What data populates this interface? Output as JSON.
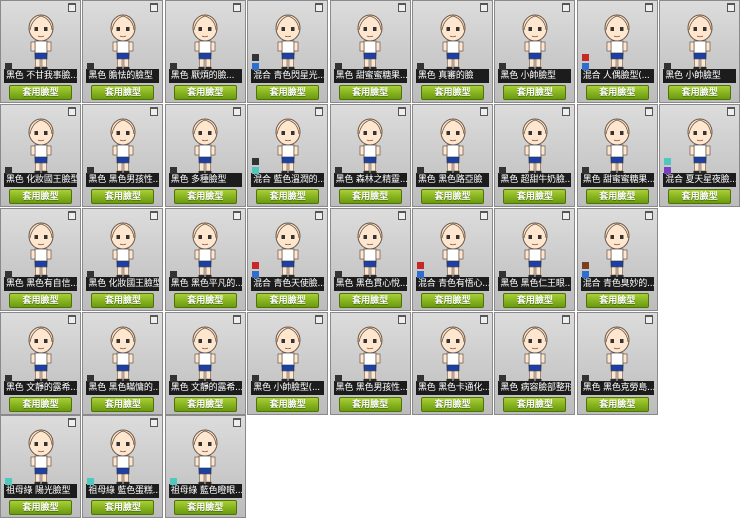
{
  "apply_label": "套用臉型",
  "colors": {
    "dark": "#333333",
    "blue": "#2f6ecf",
    "red": "#c62828",
    "teal": "#4fc9c0",
    "purple": "#7b3fc4",
    "brown": "#7a3e1e"
  },
  "cards": [
    {
      "label": "黑色  不甘我事臉...",
      "swatches": [
        "dark"
      ]
    },
    {
      "label": "黑色  膽怯的臉型",
      "swatches": [
        "dark"
      ]
    },
    {
      "label": "黑色  厭煩的臉...",
      "swatches": [
        "dark"
      ]
    },
    {
      "label": "混合  青色閃星光...",
      "swatches": [
        "dark",
        "blue"
      ]
    },
    {
      "label": "黑色  甜蜜蜜糖果...",
      "swatches": [
        "dark"
      ]
    },
    {
      "label": "黑色  真審的臉",
      "swatches": [
        "dark"
      ]
    },
    {
      "label": "黑色  小帥臉型",
      "swatches": [
        "dark"
      ]
    },
    {
      "label": "混合  人偶臉型(...",
      "swatches": [
        "red",
        "blue"
      ]
    },
    {
      "label": "黑色  小帥臉型",
      "swatches": [
        "dark"
      ]
    },
    {
      "label": "黑色  化妝國王臉型",
      "swatches": [
        "dark"
      ]
    },
    {
      "label": "黑色  黑色男孩性...",
      "swatches": [
        "dark"
      ]
    },
    {
      "label": "黑色  多種臉型",
      "swatches": [
        "dark"
      ]
    },
    {
      "label": "混合  藍色溫潤的...",
      "swatches": [
        "dark",
        "teal"
      ]
    },
    {
      "label": "黑色  森林之精靈...",
      "swatches": [
        "dark"
      ]
    },
    {
      "label": "黑色  黑色路亞臉",
      "swatches": [
        "dark"
      ]
    },
    {
      "label": "黑色  超甜牛奶臉...",
      "swatches": [
        "dark"
      ]
    },
    {
      "label": "黑色  甜蜜蜜糖果...",
      "swatches": [
        "dark"
      ]
    },
    {
      "label": "混合  夏天星夜臉...",
      "swatches": [
        "teal",
        "purple"
      ]
    },
    {
      "label": "黑色  黑色有自信...",
      "swatches": [
        "dark"
      ]
    },
    {
      "label": "黑色  化妝國王臉型",
      "swatches": [
        "dark"
      ]
    },
    {
      "label": "黑色  黑色平凡的...",
      "swatches": [
        "dark"
      ]
    },
    {
      "label": "混合  青色天使臉...",
      "swatches": [
        "red",
        "blue"
      ]
    },
    {
      "label": "黑色  黑色貫心悅...",
      "swatches": [
        "dark"
      ]
    },
    {
      "label": "混合  青色有悟心...",
      "swatches": [
        "red",
        "blue"
      ]
    },
    {
      "label": "黑色  黑色仁王眼...",
      "swatches": [
        "dark"
      ]
    },
    {
      "label": "混合  青色臭妙的...",
      "swatches": [
        "brown",
        "blue"
      ]
    },
    {
      "label": "黑色  文靜的露希...",
      "swatches": [
        "dark"
      ]
    },
    {
      "label": "黑色  黑色瞞慵的...",
      "swatches": [
        "dark"
      ]
    },
    {
      "label": "黑色  文靜的露希...",
      "swatches": [
        "dark"
      ]
    },
    {
      "label": "黑色  小帥臉型(...",
      "swatches": [
        "dark"
      ]
    },
    {
      "label": "黑色  黑色男孩性...",
      "swatches": [
        "dark"
      ]
    },
    {
      "label": "黑色  黑色卡通化...",
      "swatches": [
        "dark"
      ]
    },
    {
      "label": "黑色  病容臉部整形",
      "swatches": [
        "dark"
      ]
    },
    {
      "label": "黑色  黑色克勞島...",
      "swatches": [
        "dark"
      ]
    },
    {
      "label": "祖母綠  陽光臉型",
      "swatches": [
        "teal"
      ]
    },
    {
      "label": "祖母綠  藍色蛋糕...",
      "swatches": [
        "teal"
      ]
    },
    {
      "label": "祖母綠  藍色瞪眼...",
      "swatches": [
        "teal"
      ]
    }
  ]
}
